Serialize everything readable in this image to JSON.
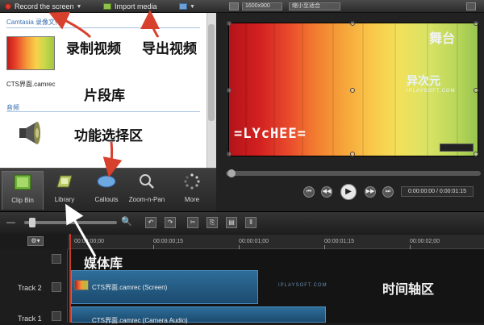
{
  "toolbar": {
    "record_label": "Record the screen",
    "import_label": "Import media"
  },
  "preview": {
    "size_field": "1600x900",
    "zoom_field": "缩小至适合",
    "timecode": "0:00:00:00 / 0:00:01:15",
    "watermark_title": "异次元",
    "watermark_sub": "IPLAYSOFT.COM",
    "lychee": "=LYcHEE="
  },
  "clipbin": {
    "folder_title": "Camtasia 录像文件",
    "clip_caption": "CTS界面.camrec",
    "audio_heading": "音频"
  },
  "tools": [
    {
      "label": "Clip Bin",
      "icon": "film-strip-icon"
    },
    {
      "label": "Library",
      "icon": "library-icon"
    },
    {
      "label": "Callouts",
      "icon": "callout-icon"
    },
    {
      "label": "Zoom-n-Pan",
      "icon": "magnifier-icon"
    },
    {
      "label": "More",
      "icon": "more-icon"
    }
  ],
  "timeline": {
    "ticks": [
      "00:00:00;00",
      "00:00:00;15",
      "00:00:01;00",
      "00:00:01;15",
      "00:00:02;00"
    ],
    "tracks": [
      {
        "name": "Track 2",
        "clip_label": "CTS界面.camrec (Screen)"
      },
      {
        "name": "Track 1",
        "clip_label": "CTS界面.camrec (Camera Audio)"
      }
    ],
    "track_watermark": "IPLAYSOFT.COM"
  },
  "annotations": {
    "record": "录制视频",
    "export": "导出视频",
    "clip_library": "片段库",
    "stage": "舞台",
    "function_area": "功能选择区",
    "media_library": "媒体库",
    "timeline_area": "时间轴区"
  },
  "colors": {
    "accent_red": "#c73a2c",
    "clip_blue": "#2e6e9a",
    "folder_blue": "#3a6fb0"
  }
}
